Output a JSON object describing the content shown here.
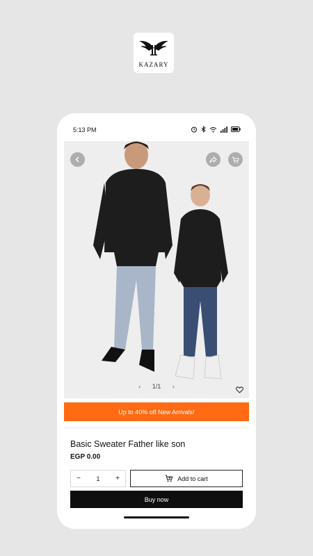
{
  "brand": {
    "name": "KAZARY"
  },
  "status_bar": {
    "time": "5:13 PM"
  },
  "gallery": {
    "pager": "1/1",
    "prev_arrow": "‹",
    "next_arrow": "›"
  },
  "promo": {
    "text": "Up to 40% off New Arrivals!"
  },
  "product": {
    "title": "Basic Sweater Father like son",
    "price": "EGP 0.00"
  },
  "quantity": {
    "minus": "−",
    "value": "1",
    "plus": "+"
  },
  "actions": {
    "add_to_cart": "Add to cart",
    "buy_now": "Buy now"
  },
  "colors": {
    "promo_bg": "#ff6a13",
    "buy_bg": "#0e0e0e",
    "page_bg": "#e6e6e6"
  }
}
